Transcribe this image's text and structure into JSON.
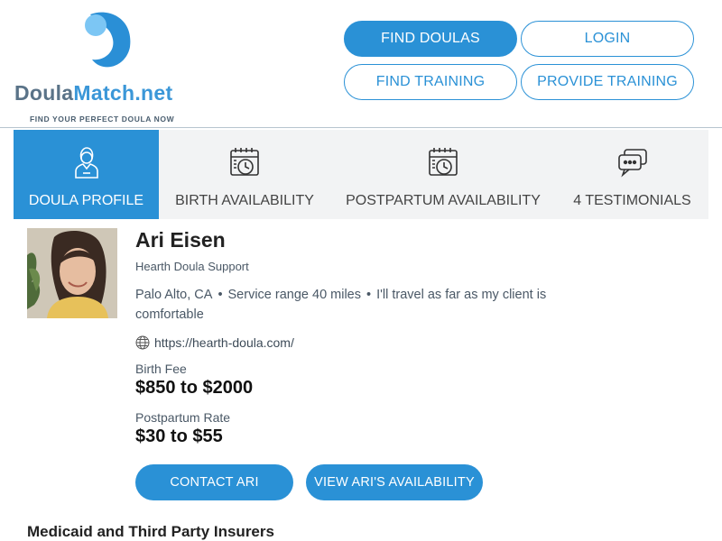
{
  "logo": {
    "brand_part1": "Doula",
    "brand_part2": "Match.net",
    "tagline": "FIND YOUR PERFECT DOULA NOW",
    "colors": {
      "blue": "#3b97d8",
      "light_blue": "#6bbef0",
      "slate": "#5a7388"
    }
  },
  "nav": {
    "find_doulas": "FIND DOULAS",
    "login": "LOGIN",
    "find_training": "FIND TRAINING",
    "provide_training": "PROVIDE TRAINING"
  },
  "tabs": [
    {
      "label": "DOULA PROFILE",
      "icon": "doula-person-icon",
      "active": true
    },
    {
      "label": "BIRTH AVAILABILITY",
      "icon": "calendar-clock-icon",
      "active": false
    },
    {
      "label": "POSTPARTUM AVAILABILITY",
      "icon": "calendar-clock-icon",
      "active": false
    },
    {
      "label": "4 TESTIMONIALS",
      "icon": "chat-bubbles-icon",
      "active": false
    }
  ],
  "profile": {
    "name": "Ari Eisen",
    "business": "Hearth Doula Support",
    "location": "Palo Alto, CA",
    "service_range": "Service range 40 miles",
    "travel_note": "I'll travel as far as my client is comfortable",
    "separator": "•",
    "website": "https://hearth-doula.com/",
    "birth_fee_label": "Birth Fee",
    "birth_fee_value": "$850 to $2000",
    "postpartum_label": "Postpartum Rate",
    "postpartum_value": "$30 to $55",
    "contact_button": "CONTACT ARI",
    "availability_button": "VIEW ARI'S AVAILABILITY"
  },
  "sections": {
    "insurers_heading": "Medicaid and Third Party Insurers"
  },
  "colors": {
    "accent": "#2a91d6",
    "tab_bg": "#f2f3f4"
  }
}
